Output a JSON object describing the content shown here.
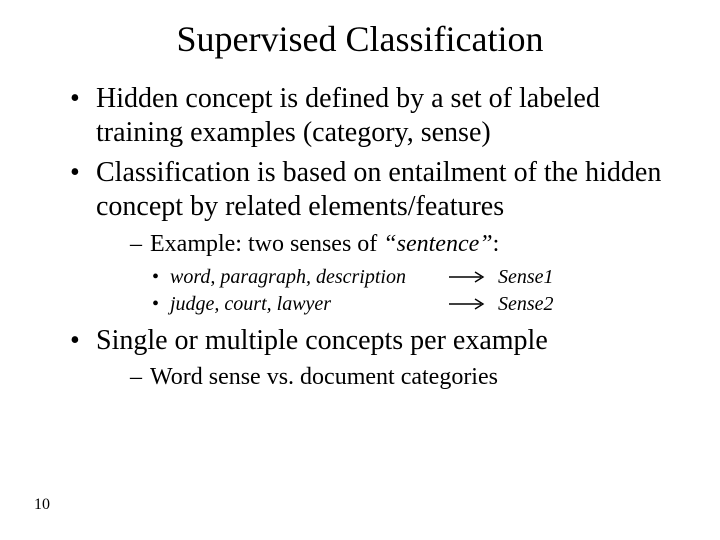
{
  "title": "Supervised Classification",
  "bullets": {
    "b1": "Hidden concept is defined by a set of labeled training examples (category, sense)",
    "b2": "Classification is based on entailment of the hidden concept by related elements/features",
    "b2_sub_prefix": "Example: two senses of ",
    "b2_sub_quoted": "“sentence”",
    "b2_sub_suffix": ":",
    "ex1_left": "word, paragraph, description",
    "ex1_right": "Sense1",
    "ex2_left": "judge, court, lawyer",
    "ex2_right": "Sense2",
    "b3": "Single or multiple concepts per example",
    "b3_sub": "Word sense vs. document categories"
  },
  "page_number": "10"
}
